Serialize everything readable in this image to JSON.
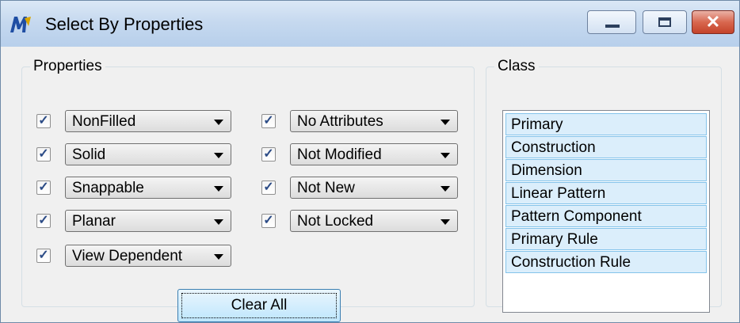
{
  "window": {
    "title": "Select By Properties",
    "close_glyph": "✕"
  },
  "properties": {
    "legend": "Properties",
    "clear_all_label": "Clear All",
    "rows": [
      {
        "checked": true,
        "value": "NonFilled"
      },
      {
        "checked": true,
        "value": "Solid"
      },
      {
        "checked": true,
        "value": "Snappable"
      },
      {
        "checked": true,
        "value": "Planar"
      },
      {
        "checked": true,
        "value": "View Dependent"
      },
      {
        "checked": true,
        "value": "No Attributes"
      },
      {
        "checked": true,
        "value": "Not Modified"
      },
      {
        "checked": true,
        "value": "Not New"
      },
      {
        "checked": true,
        "value": "Not Locked"
      }
    ]
  },
  "class": {
    "legend": "Class",
    "items": [
      "Primary",
      "Construction",
      "Dimension",
      "Linear Pattern",
      "Pattern Component",
      "Primary Rule",
      "Construction Rule"
    ]
  },
  "colors": {
    "titlebar": "#c6d9ef",
    "close_button": "#c4432a",
    "list_selection": "#dbeefb",
    "check_mark": "#2b4b86"
  },
  "icons": {
    "app": "microstation-icon",
    "minimize": "minimize-icon",
    "maximize": "maximize-icon",
    "close": "close-icon",
    "check": "check-icon",
    "dropdown": "chevron-down-icon"
  }
}
